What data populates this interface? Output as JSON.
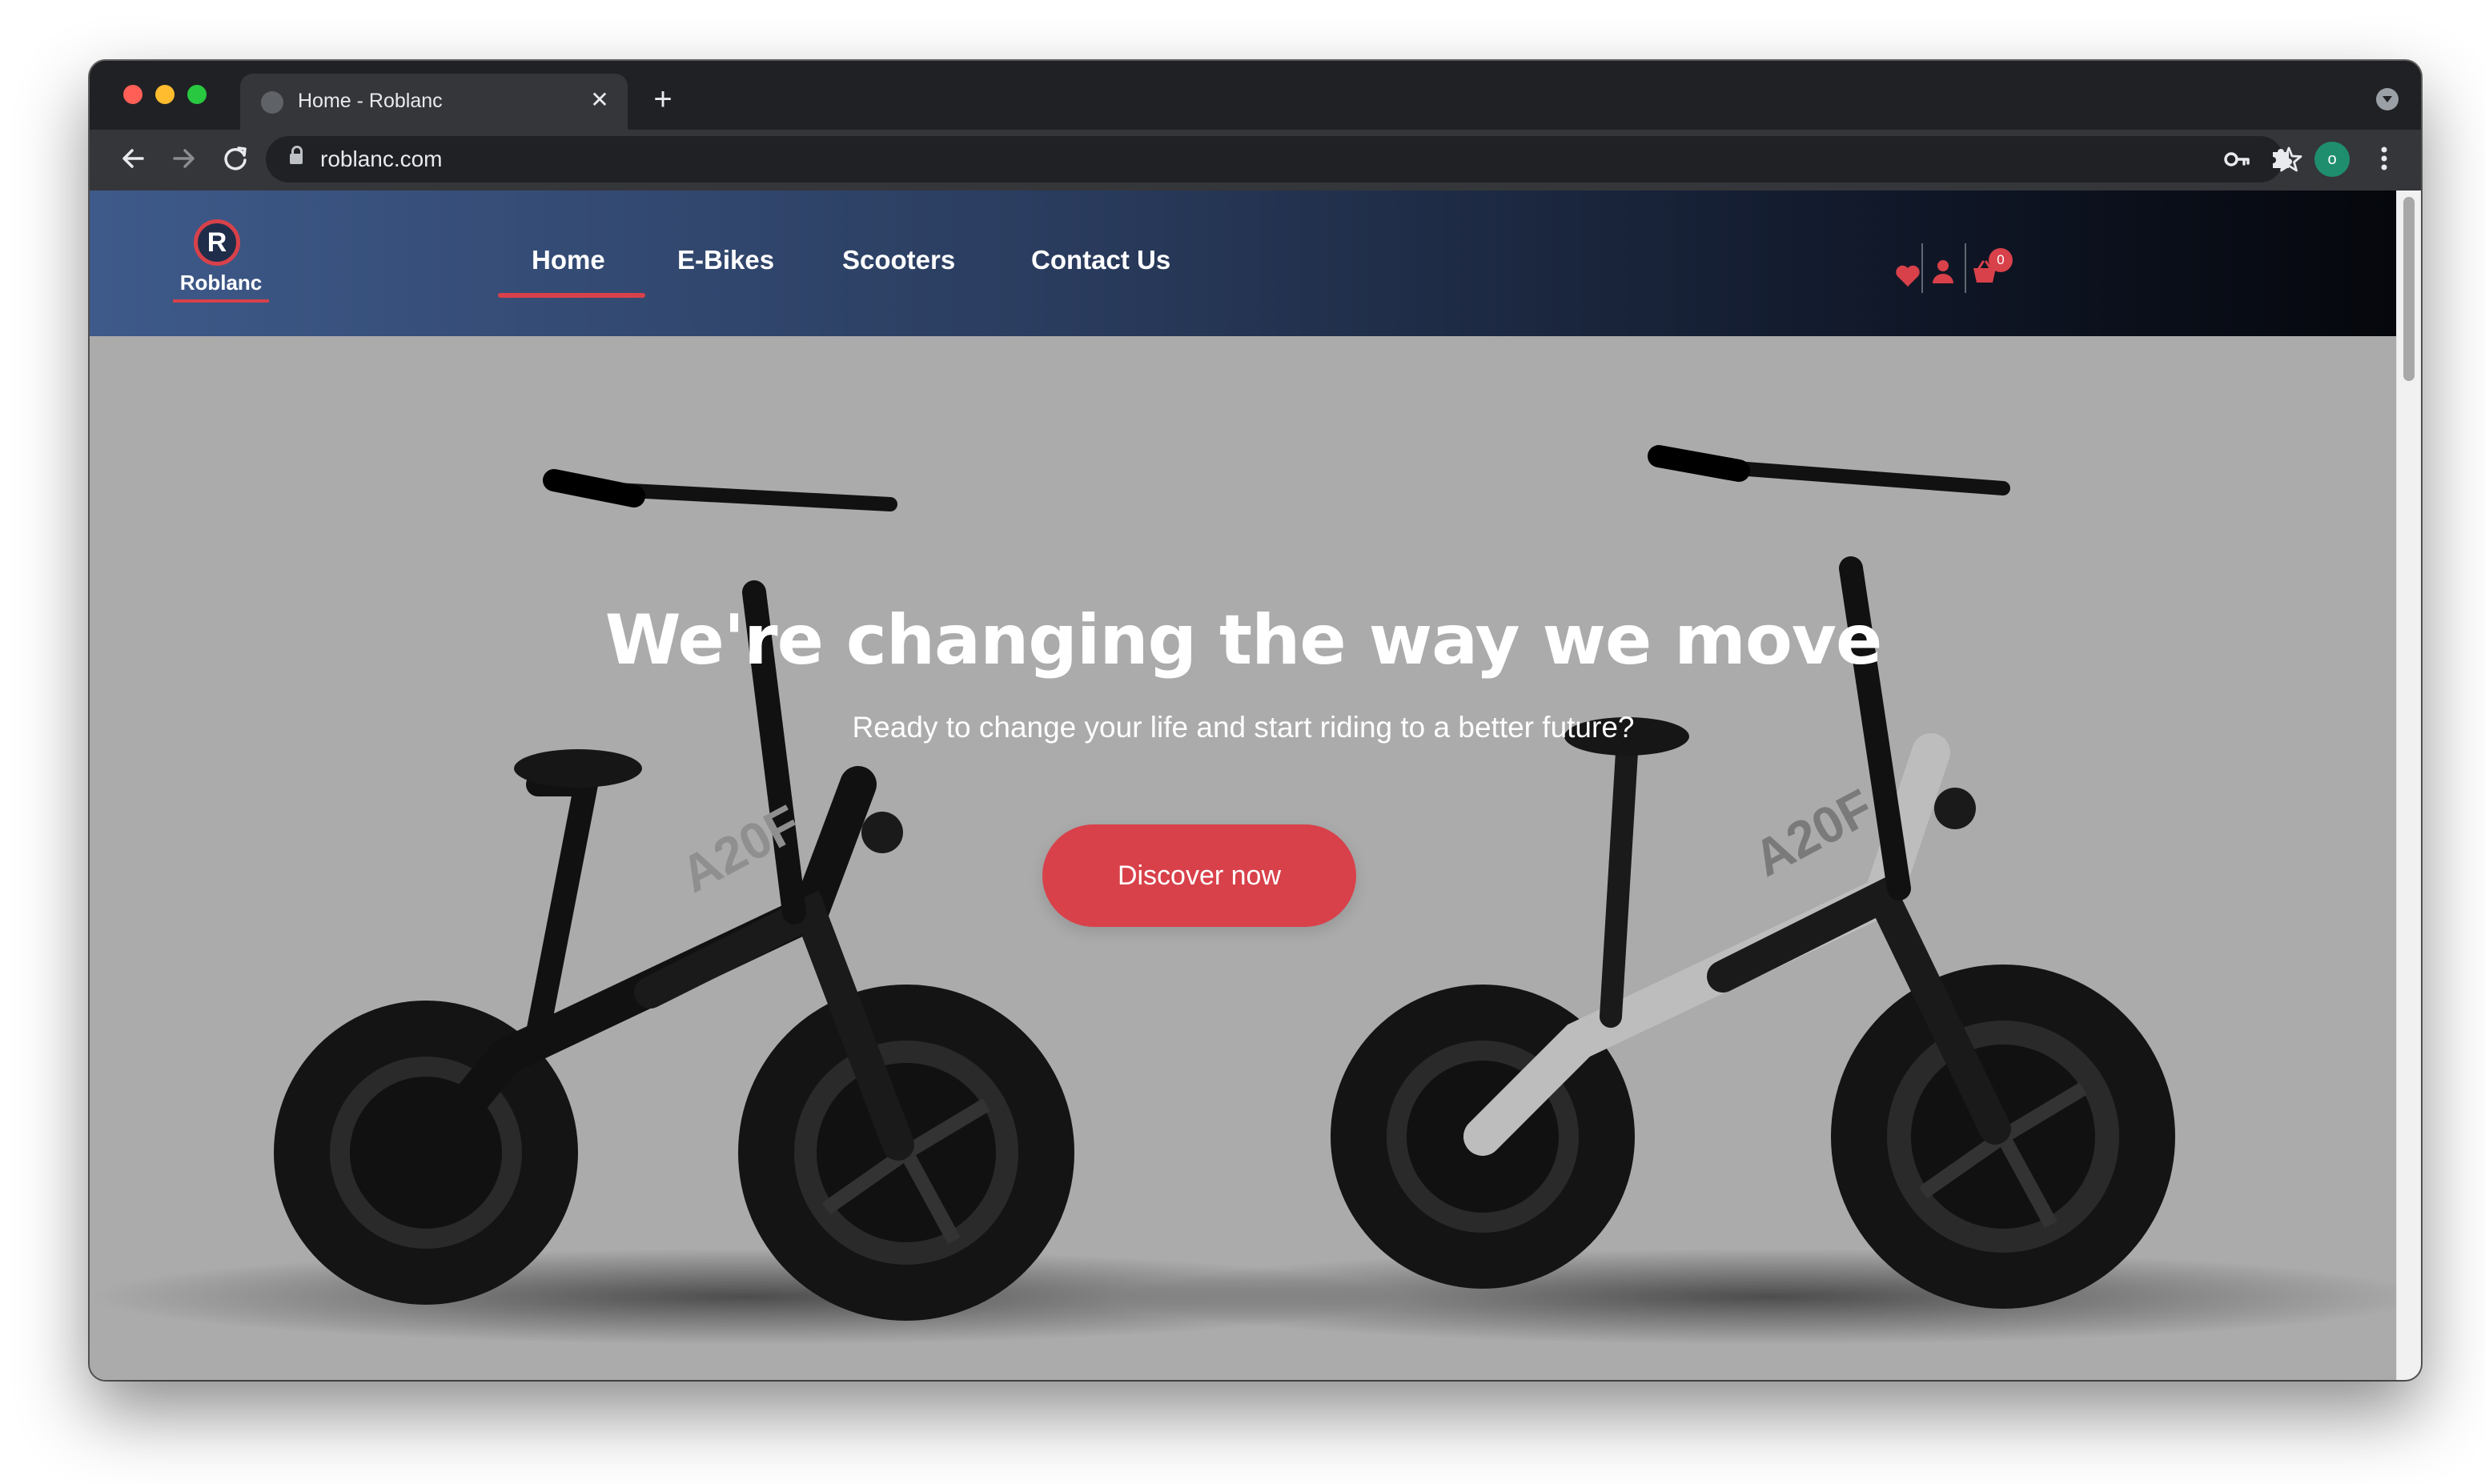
{
  "browser": {
    "tab_title": "Home - Roblanc",
    "tab_close": "✕",
    "new_tab": "+",
    "url": "roblanc.com",
    "profile_initial": "o"
  },
  "site": {
    "logo_letter": "R",
    "logo_text": "Roblanc",
    "nav": {
      "home": "Home",
      "ebikes": "E-Bikes",
      "scooters": "Scooters",
      "contact": "Contact Us"
    },
    "cart_count": "0",
    "accent_color": "#d8414a"
  },
  "hero": {
    "title": "We're changing the way we move",
    "subtitle": "Ready to change your life and start riding to a better future?",
    "button_label": "Discover now",
    "bike_left_label": "A20F",
    "bike_right_label": "A20F"
  }
}
